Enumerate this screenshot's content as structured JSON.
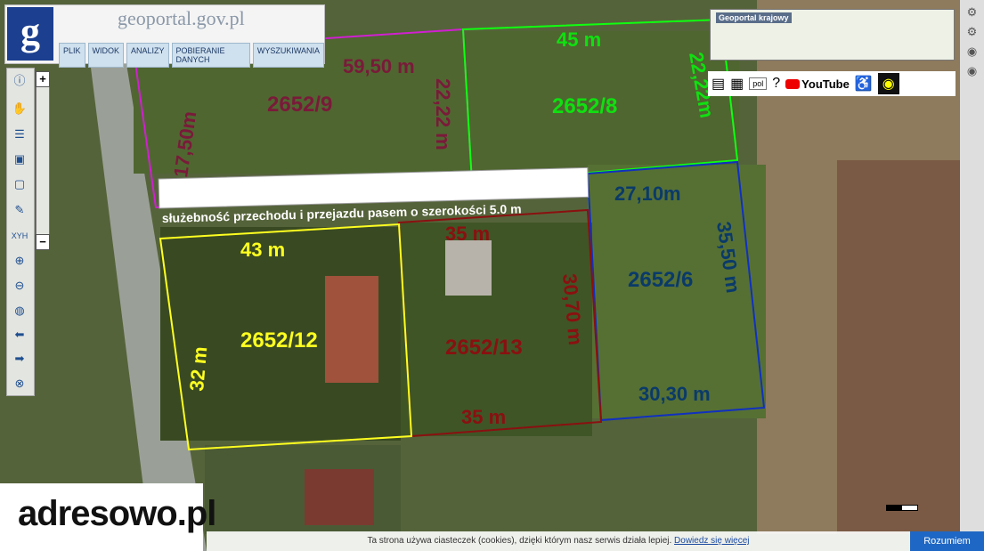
{
  "header": {
    "logo_letter": "g",
    "brand": "geoportal.gov.pl",
    "menu": [
      "PLIK",
      "WIDOK",
      "ANALIZY",
      "POBIERANIE DANYCH",
      "WYSZUKIWANIA"
    ]
  },
  "minimap": {
    "title": "Geoportal krajowy"
  },
  "toolbar": {
    "lang": "pol",
    "youtube": "YouTube"
  },
  "labels": {
    "dim_59_50": "59,50 m",
    "dim_45": "45 m",
    "dim_17_50": "17,50m",
    "dim_22_22_left": "22,22 m",
    "dim_22_22_right": "22,22m",
    "p_2652_9": "2652/9",
    "p_2652_8": "2652/8",
    "easement": "służebność przechodu i przejazdu pasem o szerokości 5.0 m",
    "dim_27_10": "27,10m",
    "dim_35_50": "35,50 m",
    "p_2652_6": "2652/6",
    "dim_30_30": "30,30 m",
    "dim_43": "43 m",
    "dim_32": "32 m",
    "p_2652_12": "2652/12",
    "dim_35_top": "35 m",
    "dim_30_70": "30,70 m",
    "p_2652_13": "2652/13",
    "dim_35_bottom": "35 m"
  },
  "footer": {
    "brand": "adresowo.pl",
    "cookie_text": "Ta strona używa ciasteczek (cookies), dzięki którym nasz serwis działa lepiej.",
    "cookie_link": "Dowiedz się więcej",
    "accept": "Rozumiem"
  }
}
